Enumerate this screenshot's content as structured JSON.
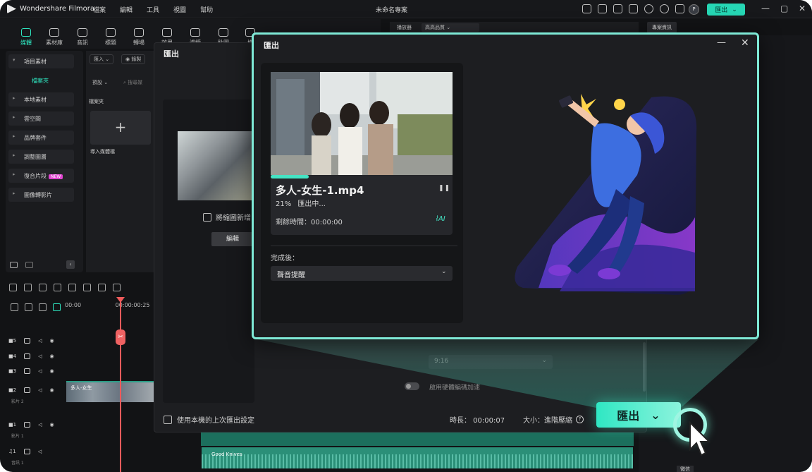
{
  "app": {
    "brand": "Wondershare Filmora",
    "menu": [
      "檔案",
      "編輯",
      "工具",
      "視圖",
      "幫助"
    ],
    "project_title": "未命名專案",
    "avatar_initial": "P",
    "export_button": "匯出",
    "window_controls": [
      "—",
      "▢",
      "✕"
    ]
  },
  "toolbar": {
    "tools": [
      "媒體",
      "素材庫",
      "音訊",
      "標題",
      "轉場",
      "效果",
      "濾鏡",
      "貼圖",
      "模"
    ],
    "active_index": 0
  },
  "left_panel": {
    "items": [
      "項目素材",
      "本地素材",
      "雲空間",
      "品牌套件",
      "調整圖層",
      "復合片段",
      "圖像轉影片"
    ],
    "selected_sub": "檔案夾",
    "new_badge": "NEW"
  },
  "media_panel": {
    "import_btn": "匯入",
    "record_btn": "錄製",
    "sort": "預設",
    "search_placeholder": "搜尋媒",
    "folder_label": "檔案夾",
    "import_label": "導入媒體檔"
  },
  "timeline": {
    "ruler": [
      "00:00",
      "00:00:00:25"
    ],
    "tracks": [
      {
        "num": "5",
        "sub": ""
      },
      {
        "num": "4",
        "sub": ""
      },
      {
        "num": "3",
        "sub": ""
      },
      {
        "num": "2",
        "sub": "影片 2"
      },
      {
        "num": "1",
        "sub": "影片 1"
      },
      {
        "num": "1",
        "sub": "音訊 1"
      }
    ],
    "video_clip_label": "多人-女生",
    "audio_clip_label": "Good Knives"
  },
  "player": {
    "label": "播放器",
    "quality": "高高品質",
    "project_info": "專案資訊"
  },
  "mid_dialog": {
    "title": "匯出",
    "checkbox_label": "將縮圖新增",
    "edit_button": "編輯",
    "ratio": "9:16",
    "hw_accel": "啟用硬體編碼加速",
    "footer_checkbox": "使用本機的上次匯出設定",
    "duration": "時長： 00:00:07",
    "size": "大小：進階壓縮"
  },
  "export_dialog": {
    "title": "匯出",
    "file_name": "多人-女生-1.mp4",
    "percent_text": "21%",
    "status": "匯出中...",
    "progress": 0.21,
    "remaining": "剩餘時間：00:00:00",
    "after_label": "完成後：",
    "after_option": "聲音提醒",
    "ai_icon": "AI"
  },
  "overlay": {
    "big_export": "匯出",
    "bottom_tag": "微信"
  },
  "colors": {
    "accent": "#2ee6c0",
    "dialog_border": "#7ee9d6",
    "playhead": "#ef5b5b"
  }
}
